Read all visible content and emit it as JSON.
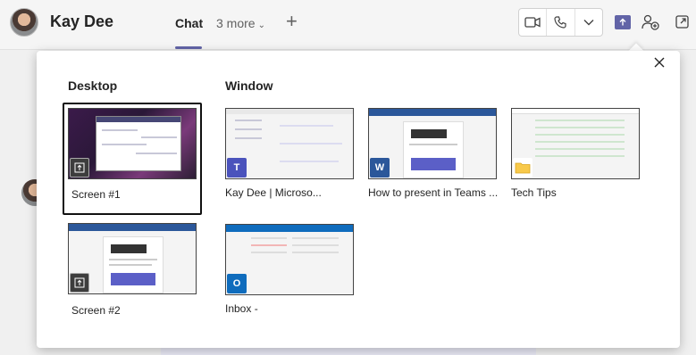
{
  "header": {
    "contact_name": "Kay Dee",
    "tabs": {
      "chat": "Chat",
      "more": "3 more"
    },
    "icons": {
      "add_tab": "plus-icon",
      "video": "video-camera-icon",
      "audio": "phone-icon",
      "dropdown": "chevron-down-icon",
      "share": "share-screen-icon",
      "people": "add-people-icon",
      "popout": "pop-out-icon"
    },
    "accent_color": "#6264a7"
  },
  "share_tray": {
    "close_icon": "close-icon",
    "desktop": {
      "title": "Desktop",
      "screens": [
        {
          "label": "Screen #1",
          "selected": true
        },
        {
          "label": "Screen #2",
          "selected": false
        }
      ]
    },
    "window": {
      "title": "Window",
      "items": [
        {
          "label": "Kay Dee            | Microso...",
          "app": "Teams"
        },
        {
          "label": "How to present in Teams ...",
          "app": "Word"
        },
        {
          "label": "Tech Tips",
          "app": "File Explorer"
        },
        {
          "label": "Inbox -",
          "app": "Outlook"
        }
      ]
    }
  }
}
